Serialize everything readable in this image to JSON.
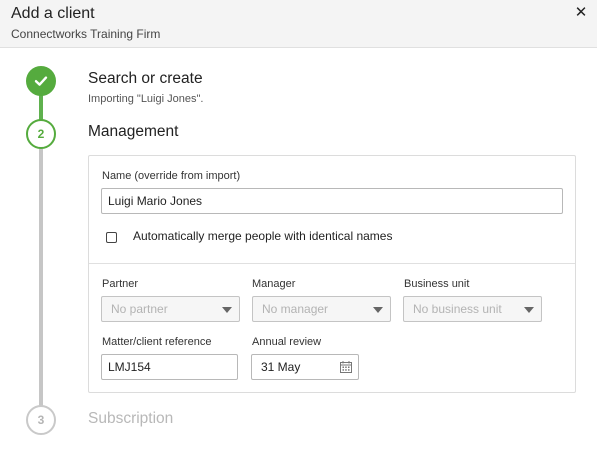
{
  "dialog": {
    "title": "Add a client",
    "subtitle": "Connectworks Training Firm",
    "close_icon": "close-icon"
  },
  "steps": [
    {
      "number": "1",
      "title": "Search or create",
      "subtitle": "Importing \"Luigi Jones\".",
      "state": "done",
      "icon": "check-icon"
    },
    {
      "number": "2",
      "title": "Management",
      "state": "active"
    },
    {
      "number": "3",
      "title": "Subscription",
      "state": "pending"
    }
  ],
  "form": {
    "name_label": "Name (override from import)",
    "name_value": "Luigi Mario Jones",
    "merge_label": "Automatically merge people with identical names",
    "merge_checked": false,
    "partner_label": "Partner",
    "partner_value": "No partner",
    "manager_label": "Manager",
    "manager_value": "No manager",
    "business_unit_label": "Business unit",
    "business_unit_value": "No business unit",
    "reference_label": "Matter/client reference",
    "reference_value": "LMJ154",
    "annual_review_label": "Annual review",
    "annual_review_value": "31 May",
    "calendar_icon": "calendar-icon"
  },
  "colors": {
    "accent_green": "#55ab3e",
    "rail_gray": "#c6c6c6",
    "disabled_text": "#b8b8b8"
  }
}
